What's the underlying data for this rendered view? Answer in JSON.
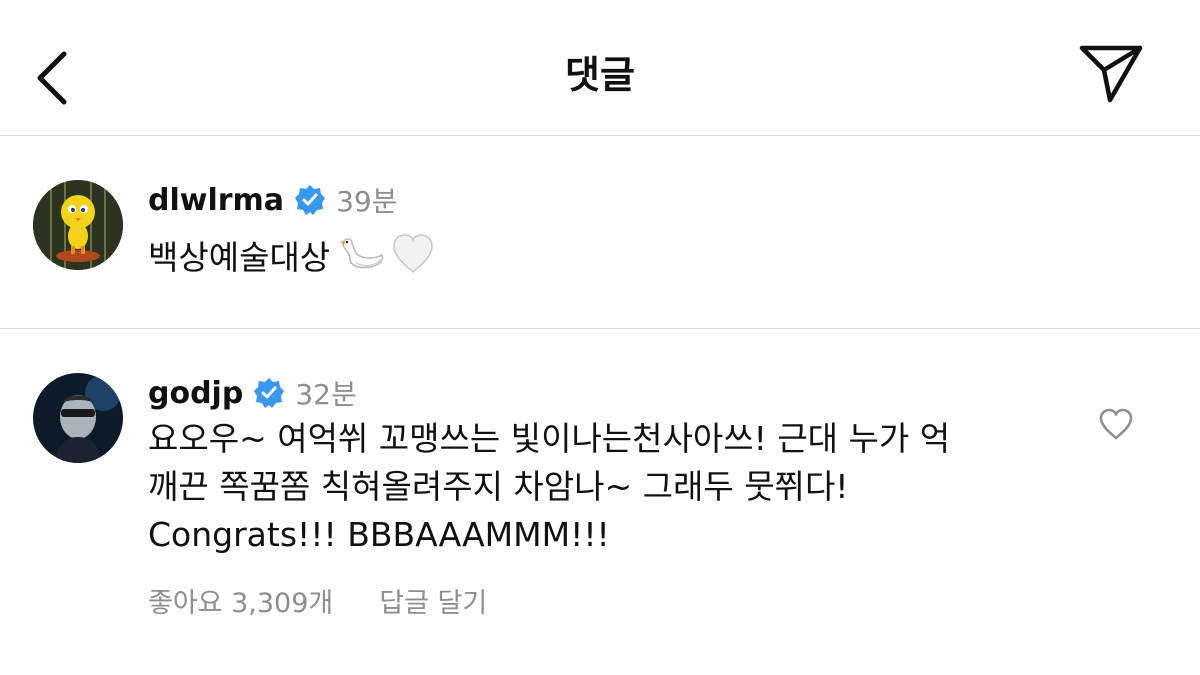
{
  "header": {
    "title": "댓글",
    "back_icon": "chevron-left-icon",
    "send_icon": "paper-plane-icon"
  },
  "comments": [
    {
      "username": "dlwlrma",
      "verified": true,
      "time": "39분",
      "text": "백상예술대상",
      "emojis": [
        "swan-icon",
        "white-heart-icon"
      ]
    },
    {
      "username": "godjp",
      "verified": true,
      "time": "32분",
      "text_lines": [
        "요오우~ 여억쒸 꼬맹쓰는 빛이나는천사아쓰! 근대 누가 억",
        "깨끈 쪽꿈쫌 칙혀올려주지 차암나~ 그래두 뭇쮜다!",
        "Congrats!!! BBBAAAMMM!!!"
      ],
      "likes_label": "좋아요 3,309개",
      "reply_label": "답글 달기",
      "like_icon": "heart-outline-icon"
    }
  ],
  "colors": {
    "verified_blue": "#3897f0",
    "secondary_text": "#8e8e8e",
    "divider": "#dcdcdc"
  }
}
